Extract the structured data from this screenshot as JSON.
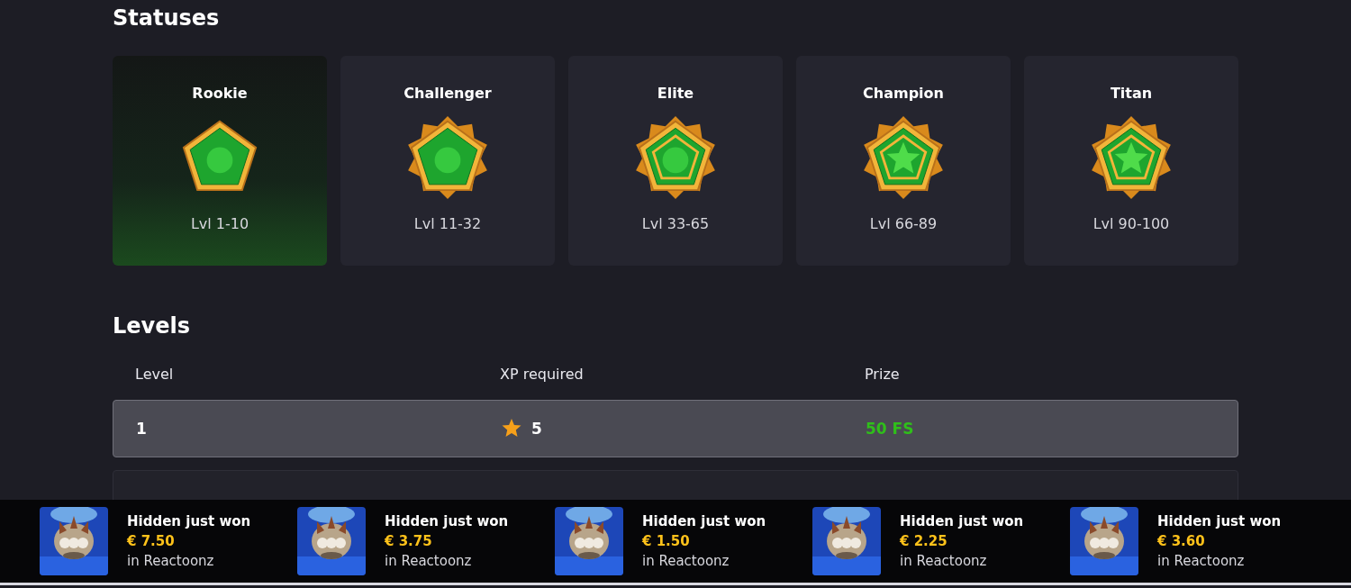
{
  "statuses_title": "Statuses",
  "statuses": [
    {
      "name": "Rookie",
      "range": "Lvl 1-10",
      "kind": "plain",
      "selected": true
    },
    {
      "name": "Challenger",
      "range": "Lvl 11-32",
      "kind": "spiked",
      "selected": false
    },
    {
      "name": "Elite",
      "range": "Lvl 33-65",
      "kind": "framed",
      "selected": false
    },
    {
      "name": "Champion",
      "range": "Lvl 66-89",
      "kind": "star",
      "selected": false
    },
    {
      "name": "Titan",
      "range": "Lvl 90-100",
      "kind": "star",
      "selected": false
    }
  ],
  "levels_title": "Levels",
  "levels_table": {
    "columns": [
      "Level",
      "XP required",
      "Prize"
    ],
    "rows": [
      {
        "level": "1",
        "xp": "5",
        "prize": "50 FS",
        "selected": true
      }
    ]
  },
  "ticker": [
    {
      "title": "Hidden just won",
      "amount": "€ 7.50",
      "game": "in Reactoonz"
    },
    {
      "title": "Hidden just won",
      "amount": "€ 3.75",
      "game": "in Reactoonz"
    },
    {
      "title": "Hidden just won",
      "amount": "€ 1.50",
      "game": "in Reactoonz"
    },
    {
      "title": "Hidden just won",
      "amount": "€ 2.25",
      "game": "in Reactoonz"
    },
    {
      "title": "Hidden just won",
      "amount": "€ 3.60",
      "game": "in Reactoonz"
    }
  ]
}
